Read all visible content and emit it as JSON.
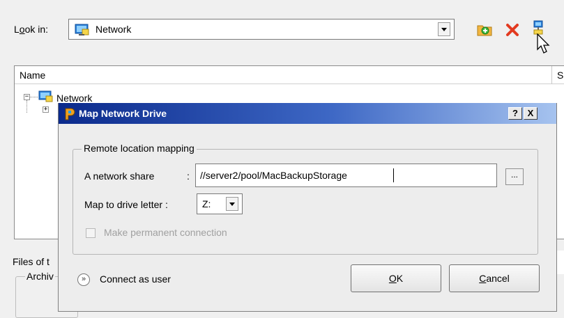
{
  "file_dialog": {
    "look_in_prefix": "L",
    "look_in_underlined": "o",
    "look_in_suffix": "ok in:",
    "look_in_value": "Network",
    "toolbar_icons": [
      "new-folder-icon",
      "delete-icon",
      "map-network-drive-icon"
    ],
    "column_name": "Name",
    "column_size_partial": "S",
    "tree_root": "Network",
    "files_of_type_label": "Files of t",
    "archive_label": "Archiv"
  },
  "dialog": {
    "title": "Map Network Drive",
    "help_button": "?",
    "close_button": "X",
    "group_title": "Remote location mapping",
    "share_label": "A network share",
    "share_colon": ":",
    "share_value": "//server2/pool/MacBackupStorage",
    "browse_label": "...",
    "drive_label": "Map to drive letter :",
    "drive_value": "Z:",
    "permanent_label": "Make permanent connection",
    "connect_as_user": "Connect as user",
    "ok_underlined": "O",
    "ok_suffix": "K",
    "cancel_underlined": "C",
    "cancel_suffix": "ancel"
  },
  "colors": {
    "titlebar_start": "#0b2a8c",
    "titlebar_end": "#a6c3ef",
    "disabled_text": "#a0a0a0"
  }
}
